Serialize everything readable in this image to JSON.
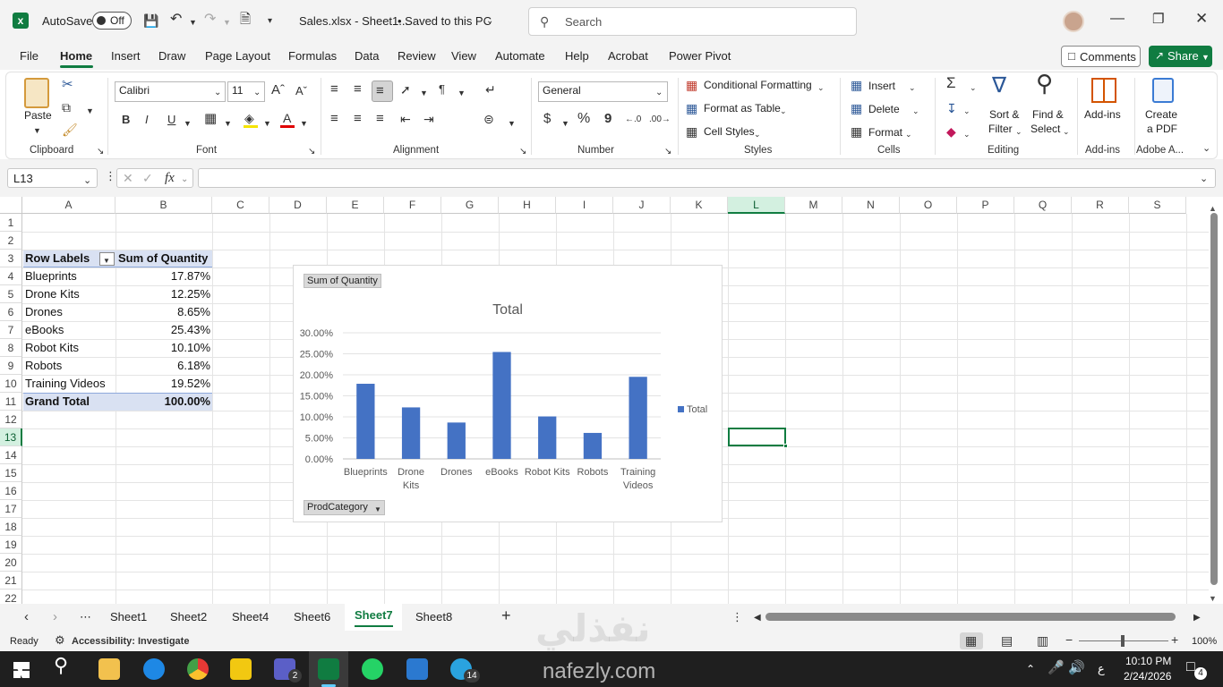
{
  "titlebar": {
    "autosave_label": "AutoSave",
    "autosave_state": "Off",
    "filename": "Sales.xlsx - Sheet1...",
    "save_status": "• Saved to this PC",
    "search_placeholder": "Search"
  },
  "menu": {
    "tabs": [
      "File",
      "Home",
      "Insert",
      "Draw",
      "Page Layout",
      "Formulas",
      "Data",
      "Review",
      "View",
      "Automate",
      "Help",
      "Acrobat",
      "Power Pivot"
    ],
    "active": "Home",
    "comments_label": "Comments",
    "share_label": "Share"
  },
  "ribbon": {
    "clipboard": {
      "label": "Clipboard",
      "paste": "Paste"
    },
    "font": {
      "label": "Font",
      "name": "Calibri",
      "size": "11",
      "bold": "B",
      "italic": "I",
      "underline": "U"
    },
    "alignment": {
      "label": "Alignment"
    },
    "number": {
      "label": "Number",
      "format": "General",
      "currency": "$",
      "percent": "%",
      "comma": "9"
    },
    "styles": {
      "label": "Styles",
      "conditional": "Conditional Formatting",
      "format_table": "Format as Table",
      "cell_styles": "Cell Styles"
    },
    "cells": {
      "label": "Cells",
      "insert": "Insert",
      "delete": "Delete",
      "format": "Format"
    },
    "editing": {
      "label": "Editing",
      "sort": "Sort &",
      "filter": "Filter",
      "find": "Find &",
      "select": "Select"
    },
    "addins": {
      "label": "Add-ins",
      "btn": "Add-ins"
    },
    "adobe": {
      "label": "Adobe A...",
      "create": "Create",
      "pdf": "a PDF"
    }
  },
  "formula_bar": {
    "name_box": "L13",
    "fx": "fx",
    "value": ""
  },
  "grid": {
    "columns": [
      "A",
      "B",
      "C",
      "D",
      "E",
      "F",
      "G",
      "H",
      "I",
      "J",
      "K",
      "L",
      "M",
      "N",
      "O",
      "P",
      "Q",
      "R",
      "S"
    ],
    "rows": [
      "1",
      "2",
      "3",
      "4",
      "5",
      "6",
      "7",
      "8",
      "9",
      "10",
      "11",
      "12",
      "13",
      "14",
      "15",
      "16",
      "17",
      "18",
      "19",
      "20",
      "21",
      "22"
    ],
    "selected_cell": "L13",
    "pivot": {
      "header_label": "Row Labels",
      "header_value": "Sum of Quantity",
      "rows": [
        {
          "label": "Blueprints",
          "value": "17.87%"
        },
        {
          "label": "Drone Kits",
          "value": "12.25%"
        },
        {
          "label": "Drones",
          "value": "8.65%"
        },
        {
          "label": "eBooks",
          "value": "25.43%"
        },
        {
          "label": "Robot Kits",
          "value": "10.10%"
        },
        {
          "label": "Robots",
          "value": "6.18%"
        },
        {
          "label": "Training Videos",
          "value": "19.52%"
        }
      ],
      "total_label": "Grand Total",
      "total_value": "100.00%"
    }
  },
  "chart_data": {
    "type": "bar",
    "title": "Total",
    "field_button": "Sum of Quantity",
    "axis_button": "ProdCategory",
    "categories": [
      "Blueprints",
      "Drone Kits",
      "Drones",
      "eBooks",
      "Robot Kits",
      "Robots",
      "Training Videos"
    ],
    "series": [
      {
        "name": "Total",
        "values": [
          17.87,
          12.25,
          8.65,
          25.43,
          10.1,
          6.18,
          19.52
        ],
        "color": "#4472c4"
      }
    ],
    "ylim": [
      0,
      30
    ],
    "yticks": [
      "0.00%",
      "5.00%",
      "10.00%",
      "15.00%",
      "20.00%",
      "25.00%",
      "30.00%"
    ],
    "grid": true,
    "legend": "right"
  },
  "sheets": {
    "tabs": [
      "Sheet1",
      "Sheet2",
      "Sheet4",
      "Sheet6",
      "Sheet7",
      "Sheet8"
    ],
    "active": "Sheet7"
  },
  "status": {
    "ready": "Ready",
    "accessibility": "Accessibility: Investigate",
    "zoom": "100%"
  },
  "taskbar": {
    "time": "10:10 PM",
    "date": "2/24/2026",
    "lang": "ع",
    "notif_count": "4",
    "teams_badge": "2",
    "telegram_badge": "14"
  },
  "watermark": {
    "arabic": "نفذلي",
    "latin": "nafezly.com"
  },
  "colors": {
    "accent": "#107c41",
    "bar": "#4472c4",
    "pivot_header": "#d9e1f2"
  }
}
